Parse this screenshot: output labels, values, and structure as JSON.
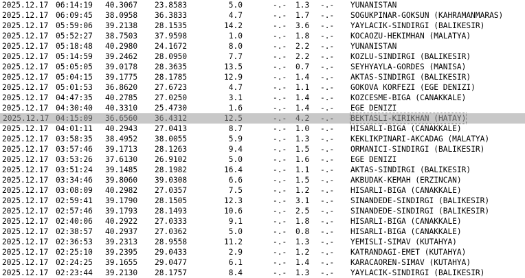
{
  "columns": [
    "date",
    "time",
    "lat",
    "lon",
    "depth",
    "md",
    "ml",
    "mw",
    "place"
  ],
  "rows": [
    {
      "date": "2025.12.17",
      "time": "06:14:19",
      "lat": "40.3067",
      "lon": "23.8583",
      "depth": "5.0",
      "md": "-.-",
      "ml": "1.3",
      "mw": "-.-",
      "place": "YUNANISTAN"
    },
    {
      "date": "2025.12.17",
      "time": "06:09:45",
      "lat": "38.0958",
      "lon": "36.3833",
      "depth": "4.7",
      "md": "-.-",
      "ml": "1.7",
      "mw": "-.-",
      "place": "SOGUKPINAR-GOKSUN (KAHRAMANMARAS)"
    },
    {
      "date": "2025.12.17",
      "time": "05:59:06",
      "lat": "39.2138",
      "lon": "28.1535",
      "depth": "14.2",
      "md": "-.-",
      "ml": "3.6",
      "mw": "-.-",
      "place": "YAYLACIK-SINDIRGI (BALIKESIR)"
    },
    {
      "date": "2025.12.17",
      "time": "05:52:27",
      "lat": "38.7503",
      "lon": "37.9598",
      "depth": "1.0",
      "md": "-.-",
      "ml": "1.8",
      "mw": "-.-",
      "place": "KOCAOZU-HEKIMHAN (MALATYA)"
    },
    {
      "date": "2025.12.17",
      "time": "05:18:48",
      "lat": "40.2980",
      "lon": "24.1672",
      "depth": "8.0",
      "md": "-.-",
      "ml": "2.2",
      "mw": "-.-",
      "place": "YUNANISTAN"
    },
    {
      "date": "2025.12.17",
      "time": "05:14:59",
      "lat": "39.2462",
      "lon": "28.0950",
      "depth": "7.7",
      "md": "-.-",
      "ml": "2.2",
      "mw": "-.-",
      "place": "KOZLU-SINDIRGI (BALIKESIR)"
    },
    {
      "date": "2025.12.17",
      "time": "05:05:05",
      "lat": "39.0178",
      "lon": "28.3635",
      "depth": "13.5",
      "md": "-.-",
      "ml": "0.7",
      "mw": "-.-",
      "place": "SEYHYAYLA-GORDES (MANISA)"
    },
    {
      "date": "2025.12.17",
      "time": "05:04:15",
      "lat": "39.1775",
      "lon": "28.1785",
      "depth": "12.9",
      "md": "-.-",
      "ml": "1.4",
      "mw": "-.-",
      "place": "AKTAS-SINDIRGI (BALIKESIR)"
    },
    {
      "date": "2025.12.17",
      "time": "05:01:53",
      "lat": "36.8620",
      "lon": "27.6723",
      "depth": "4.7",
      "md": "-.-",
      "ml": "1.1",
      "mw": "-.-",
      "place": "GOKOVA KORFEZI (EGE DENIZI)"
    },
    {
      "date": "2025.12.17",
      "time": "04:47:35",
      "lat": "40.2785",
      "lon": "27.0250",
      "depth": "3.1",
      "md": "-.-",
      "ml": "1.4",
      "mw": "-.-",
      "place": "KOZCESME-BIGA (CANAKKALE)"
    },
    {
      "date": "2025.12.17",
      "time": "04:30:40",
      "lat": "40.3310",
      "lon": "25.4730",
      "depth": "1.6",
      "md": "-.-",
      "ml": "1.4",
      "mw": "-.-",
      "place": "EGE DENIZI"
    },
    {
      "date": "2025.12.17",
      "time": "04:15:09",
      "lat": "36.6560",
      "lon": "36.4312",
      "depth": "12.5",
      "md": "-.-",
      "ml": "4.2",
      "mw": "-.-",
      "place": "BEKTASLI-KIRIKHAN (HATAY)",
      "highlight": true
    },
    {
      "date": "2025.12.17",
      "time": "04:01:11",
      "lat": "40.2943",
      "lon": "27.0413",
      "depth": "8.7",
      "md": "-.-",
      "ml": "1.0",
      "mw": "-.-",
      "place": "HISARLI-BIGA (CANAKKALE)"
    },
    {
      "date": "2025.12.17",
      "time": "03:58:35",
      "lat": "38.4952",
      "lon": "38.0055",
      "depth": "5.9",
      "md": "-.-",
      "ml": "1.3",
      "mw": "-.-",
      "place": "KEKLIKPINARI-AKCADAG (MALATYA)"
    },
    {
      "date": "2025.12.17",
      "time": "03:57:46",
      "lat": "39.1713",
      "lon": "28.1263",
      "depth": "9.4",
      "md": "-.-",
      "ml": "1.5",
      "mw": "-.-",
      "place": "ORMANICI-SINDIRGI (BALIKESIR)"
    },
    {
      "date": "2025.12.17",
      "time": "03:53:26",
      "lat": "37.6130",
      "lon": "26.9102",
      "depth": "5.0",
      "md": "-.-",
      "ml": "1.6",
      "mw": "-.-",
      "place": "EGE DENIZI"
    },
    {
      "date": "2025.12.17",
      "time": "03:51:24",
      "lat": "39.1485",
      "lon": "28.1982",
      "depth": "16.4",
      "md": "-.-",
      "ml": "1.1",
      "mw": "-.-",
      "place": "AKTAS-SINDIRGI (BALIKESIR)"
    },
    {
      "date": "2025.12.17",
      "time": "03:34:46",
      "lat": "39.8060",
      "lon": "39.0308",
      "depth": "6.6",
      "md": "-.-",
      "ml": "1.5",
      "mw": "-.-",
      "place": "AKBUDAK-KEMAH (ERZINCAN)"
    },
    {
      "date": "2025.12.17",
      "time": "03:08:09",
      "lat": "40.2982",
      "lon": "27.0357",
      "depth": "7.5",
      "md": "-.-",
      "ml": "1.2",
      "mw": "-.-",
      "place": "HISARLI-BIGA (CANAKKALE)"
    },
    {
      "date": "2025.12.17",
      "time": "02:59:41",
      "lat": "39.1790",
      "lon": "28.1505",
      "depth": "12.3",
      "md": "-.-",
      "ml": "3.1",
      "mw": "-.-",
      "place": "SINANDEDE-SINDIRGI (BALIKESIR)"
    },
    {
      "date": "2025.12.17",
      "time": "02:57:46",
      "lat": "39.1793",
      "lon": "28.1493",
      "depth": "10.6",
      "md": "-.-",
      "ml": "2.5",
      "mw": "-.-",
      "place": "SINANDEDE-SINDIRGI (BALIKESIR)"
    },
    {
      "date": "2025.12.17",
      "time": "02:40:06",
      "lat": "40.2922",
      "lon": "27.0333",
      "depth": "9.1",
      "md": "-.-",
      "ml": "1.8",
      "mw": "-.-",
      "place": "HISARLI-BIGA (CANAKKALE)"
    },
    {
      "date": "2025.12.17",
      "time": "02:38:57",
      "lat": "40.2937",
      "lon": "27.0362",
      "depth": "5.0",
      "md": "-.-",
      "ml": "0.8",
      "mw": "-.-",
      "place": "HISARLI-BIGA (CANAKKALE)"
    },
    {
      "date": "2025.12.17",
      "time": "02:36:53",
      "lat": "39.2313",
      "lon": "28.9558",
      "depth": "11.2",
      "md": "-.-",
      "ml": "1.3",
      "mw": "-.-",
      "place": "YEMISLI-SIMAV (KUTAHYA)"
    },
    {
      "date": "2025.12.17",
      "time": "02:25:10",
      "lat": "39.2395",
      "lon": "29.0433",
      "depth": "2.9",
      "md": "-.-",
      "ml": "1.2",
      "mw": "-.-",
      "place": "KATRANDAGI-EMET (KUTAHYA)"
    },
    {
      "date": "2025.12.17",
      "time": "02:24:25",
      "lat": "39.1655",
      "lon": "29.0477",
      "depth": "6.1",
      "md": "-.-",
      "ml": "1.4",
      "mw": "-.-",
      "place": "KARACAOREN-SIMAV (KUTAHYA)"
    },
    {
      "date": "2025.12.17",
      "time": "02:23:44",
      "lat": "39.2130",
      "lon": "28.1757",
      "depth": "8.4",
      "md": "-.-",
      "ml": "1.3",
      "mw": "-.-",
      "place": "YAYLACIK-SINDIRGI (BALIKESIR)"
    }
  ]
}
